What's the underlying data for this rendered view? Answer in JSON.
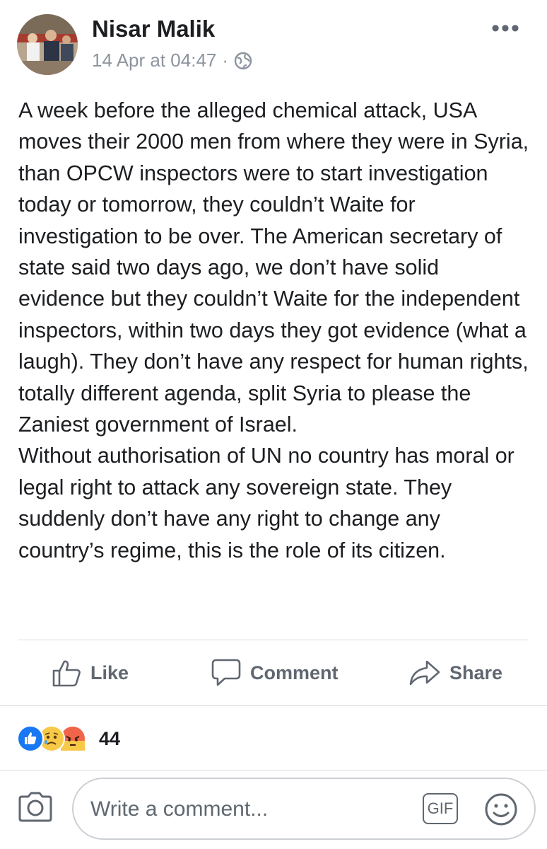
{
  "post": {
    "author": "Nisar Malik",
    "timestamp": "14 Apr at 04:47",
    "separator": "·",
    "privacy_icon": "globe-icon",
    "more_label": "•••",
    "paragraphs": [
      "A week before the alleged chemical attack, USA moves their 2000 men from where they were in Syria, than OPCW inspectors were to start investigation today or tomorrow, they couldn’t Waite for investigation to be over. The American secretary  of state said two days ago, we don’t have solid evidence but they couldn’t Waite for the independent inspectors, within two days they got evidence (what a laugh). They don’t have any respect for human rights, totally different agenda, split Syria to please the Zaniest government of Israel.",
      "Without authorisation of UN no country has moral or legal right to attack any sovereign state. They suddenly don’t have any right to change any country’s regime, this is the role of its citizen."
    ]
  },
  "actions": {
    "like": "Like",
    "comment": "Comment",
    "share": "Share"
  },
  "reactions": {
    "types": [
      "like",
      "sad",
      "angry"
    ],
    "count": "44"
  },
  "composer": {
    "placeholder": "Write a comment...",
    "gif_label": "GIF"
  },
  "colors": {
    "text": "#1c1e21",
    "secondary": "#606770",
    "meta": "#8d949e",
    "like_blue": "#1877f2",
    "angry_orange": "#f0644a",
    "sad_yellow": "#f7c948"
  }
}
